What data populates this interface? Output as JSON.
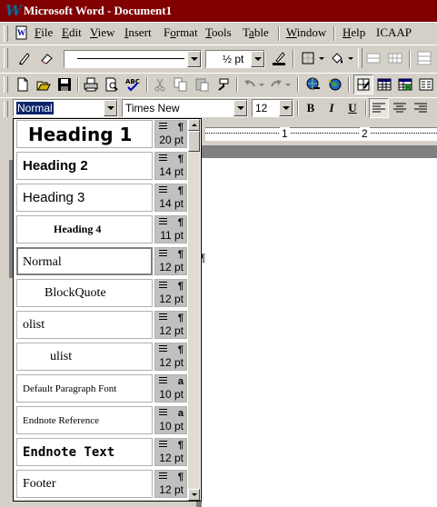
{
  "window": {
    "title": "Microsoft Word - Document1",
    "app_icon": "word-w-icon"
  },
  "menu": {
    "items": [
      {
        "label": "File",
        "accel": "F"
      },
      {
        "label": "Edit",
        "accel": "E"
      },
      {
        "label": "View",
        "accel": "V"
      },
      {
        "label": "Insert",
        "accel": "I"
      },
      {
        "label": "Format",
        "accel": "o"
      },
      {
        "label": "Tools",
        "accel": "T"
      },
      {
        "label": "Table",
        "accel": "a"
      },
      {
        "label": "Window",
        "accel": "W"
      },
      {
        "label": "Help",
        "accel": "H"
      },
      {
        "label": "ICAAP",
        "accel": ""
      }
    ]
  },
  "drawing_toolbar": {
    "line_weight": "½ pt",
    "icons": [
      "pencil-icon",
      "eraser-icon",
      "line-style-combo",
      "line-weight-combo",
      "pen-color-icon",
      "borders-icon",
      "shading-icon",
      "merge-cells-icon",
      "split-cells-icon",
      "distribute-icon"
    ]
  },
  "standard_toolbar": {
    "icons": [
      "new-icon",
      "open-icon",
      "save-icon",
      "print-icon",
      "print-preview-icon",
      "spelling-icon",
      "cut-icon",
      "copy-icon",
      "paste-icon",
      "format-painter-icon",
      "undo-icon",
      "redo-icon",
      "hyperlink-icon",
      "web-toolbar-icon",
      "tables-borders-icon",
      "insert-table-icon",
      "insert-excel-icon",
      "columns-icon"
    ]
  },
  "formatting_toolbar": {
    "style": "Normal",
    "font": "Times New",
    "size": "12",
    "bold": "B",
    "italic": "I",
    "underline": "U"
  },
  "ruler": {
    "marks": [
      "1",
      "2"
    ]
  },
  "document": {
    "paragraph_mark": "¶"
  },
  "style_list": {
    "items": [
      {
        "name": "Heading 1",
        "size": "20 pt",
        "mark": "¶",
        "selected": false
      },
      {
        "name": "Heading 2",
        "size": "14 pt",
        "mark": "¶",
        "selected": false
      },
      {
        "name": "Heading 3",
        "size": "14 pt",
        "mark": "¶",
        "selected": false
      },
      {
        "name": "Heading 4",
        "size": "11 pt",
        "mark": "¶",
        "selected": false
      },
      {
        "name": "Normal",
        "size": "12 pt",
        "mark": "¶",
        "selected": true
      },
      {
        "name": "BlockQuote",
        "size": "12 pt",
        "mark": "¶",
        "selected": false
      },
      {
        "name": "olist",
        "size": "12 pt",
        "mark": "¶",
        "selected": false
      },
      {
        "name": "ulist",
        "size": "12 pt",
        "mark": "¶",
        "selected": false
      },
      {
        "name": "Default Paragraph Font",
        "size": "10 pt",
        "mark": "a",
        "selected": false
      },
      {
        "name": "Endnote Reference",
        "size": "10 pt",
        "mark": "a",
        "selected": false
      },
      {
        "name": "Endnote Text",
        "size": "12 pt",
        "mark": "¶",
        "selected": false
      },
      {
        "name": "Footer",
        "size": "12 pt",
        "mark": "¶",
        "selected": false
      }
    ]
  },
  "colors": {
    "titlebar": "#800000",
    "face": "#d4d0c8",
    "shadow": "#808080"
  }
}
